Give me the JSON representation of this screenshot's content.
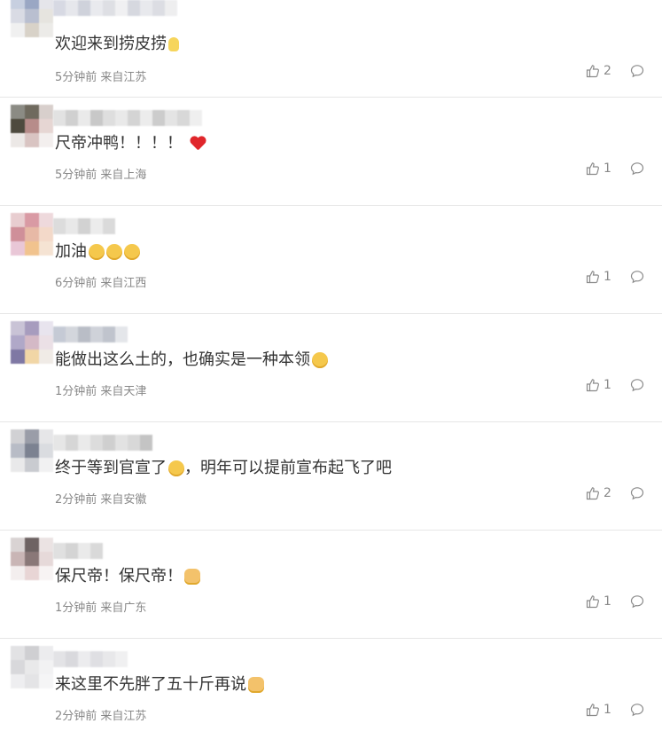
{
  "comments": [
    {
      "text": "欢迎来到捞皮捞",
      "emojis": [
        "bulb-emoji"
      ],
      "time": "5分钟前",
      "location": "来自江苏",
      "likes": "2",
      "avatar_colors": [
        "#c7cfe0",
        "#9aa7c4",
        "#e5e5ea",
        "#d9dbe4",
        "#b9bfd0",
        "#e6e4df",
        "#f0f0f0",
        "#d8d2c8",
        "#ecebe8"
      ],
      "name_colors": [
        "#d7d9e3",
        "#e6e7ec",
        "#cfd2db",
        "#e9eaee",
        "#dedfe4",
        "#f0f0f2",
        "#d6d8df",
        "#e8e9ed",
        "#dcdde3",
        "#eeeeef"
      ]
    },
    {
      "text": "尺帝冲鸭！！！！",
      "emojis": [
        "heart-emoji"
      ],
      "time": "5分钟前",
      "location": "来自上海",
      "likes": "1",
      "avatar_colors": [
        "#8b8b84",
        "#6f6a5e",
        "#d8cfcc",
        "#4e4a3e",
        "#b78c8a",
        "#e6d6d3",
        "#ece8e6",
        "#d9c4c2",
        "#f3efee"
      ],
      "name_colors": [
        "#e2e2e2",
        "#d0d0d0",
        "#eaeaea",
        "#c8c8c8",
        "#dedede",
        "#e9e9e9",
        "#d4d4d4",
        "#ececec",
        "#cccccc",
        "#e4e4e4",
        "#d8d8d8",
        "#efefef"
      ]
    },
    {
      "text": "加油",
      "emojis": [
        "grin-emoji",
        "grin-emoji",
        "grin-emoji"
      ],
      "time": "6分钟前",
      "location": "来自江西",
      "likes": "1",
      "avatar_colors": [
        "#e8cdd0",
        "#d99aa4",
        "#eed9dc",
        "#cf8f99",
        "#e7b9a6",
        "#f3d9c9",
        "#e9c7d7",
        "#f1c38e",
        "#f5e3d3"
      ],
      "name_colors": [
        "#dcdcdc",
        "#e8e8e8",
        "#d2d2d2",
        "#ececec",
        "#dadada"
      ]
    },
    {
      "text": "能做出这么土的，也确实是一种本领",
      "emojis": [
        "smile-emoji"
      ],
      "time": "1分钟前",
      "location": "来自天津",
      "likes": "1",
      "avatar_colors": [
        "#c9c3d6",
        "#a79cbe",
        "#e8e4ee",
        "#b0a8c8",
        "#d4b9c6",
        "#ebe0e6",
        "#7f78a4",
        "#f1d6a6",
        "#f0ebe6"
      ],
      "name_colors": [
        "#c5cad5",
        "#d3d6dc",
        "#b9bdc6",
        "#cfd2d9",
        "#c0c4cd",
        "#e4e6ea"
      ]
    },
    {
      "text": "终于等到官宣了",
      "text_after": "，明年可以提前宣布起飞了吧",
      "emojis": [
        "cry-emoji"
      ],
      "time": "2分钟前",
      "location": "来自安徽",
      "likes": "2",
      "avatar_colors": [
        "#d1d1d4",
        "#9a9da8",
        "#e6e6e8",
        "#b8bcc6",
        "#7c8291",
        "#dadce0",
        "#e9e9ea",
        "#c9cbd0",
        "#f1f1f2"
      ],
      "name_colors": [
        "#e6e6e6",
        "#d6d6d6",
        "#eaeaea",
        "#dcdcdc",
        "#cfcfcf",
        "#e2e2e2",
        "#d8d8d8",
        "#c4c4c4"
      ]
    },
    {
      "text": "保尺帝！保尺帝！",
      "emojis": [
        "dog-emoji"
      ],
      "time": "1分钟前",
      "location": "来自广东",
      "likes": "1",
      "avatar_colors": [
        "#d9d3d3",
        "#6e6363",
        "#ebe3e3",
        "#c9b5b5",
        "#8a7878",
        "#e6d9d9",
        "#f3eeee",
        "#e8d5d5",
        "#f7f3f3"
      ],
      "name_colors": [
        "#e0e0e0",
        "#d4d4d4",
        "#eaeaea",
        "#d9d9d9"
      ]
    },
    {
      "text": "来这里不先胖了五十斤再说",
      "emojis": [
        "dog-emoji"
      ],
      "time": "2分钟前",
      "location": "来自江苏",
      "likes": "1",
      "avatar_colors": [
        "#e2e2e4",
        "#cfcfd2",
        "#ececee",
        "#d8d8db",
        "#e9e9ea",
        "#f2f2f3",
        "#eeeef0",
        "#e4e4e6",
        "#f5f5f6"
      ],
      "name_colors": [
        "#e3e3e6",
        "#d9d9dd",
        "#ececee",
        "#dfdfe3",
        "#e8e8ea",
        "#f0f0f1"
      ]
    }
  ]
}
